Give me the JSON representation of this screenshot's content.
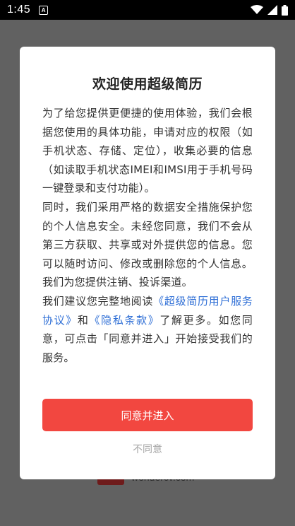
{
  "status_bar": {
    "time": "1:45",
    "notification_glyph": "A",
    "icons": [
      "wifi-icon",
      "signal-icon",
      "battery-icon"
    ]
  },
  "background": {
    "logo_text": "wondercv.com"
  },
  "dialog": {
    "title": "欢迎使用超级简历",
    "para1": "为了给您提供更便捷的使用体验，我们会根据您使用的具体功能，申请对应的权限（如手机状态、存储、定位），收集必要的信息（如读取手机状态IMEI和IMSI用于手机号码一键登录和支付功能）。",
    "para2": "同时，我们采用严格的数据安全措施保护您的个人信息安全。未经您同意，我们不会从第三方获取、共享或对外提供您的信息。您可以随时访问、修改或删除您的个人信息。我们为您提供注销、投诉渠道。",
    "para3_prefix": "我们建议您完整地阅读",
    "user_agreement_link": "《超级简历用户服务协议》",
    "para3_and": "和",
    "privacy_link": "《隐私条款》",
    "para3_suffix": "了解更多。如您同意，可点击「同意并进入」开始接受我们的服务。",
    "agree_label": "同意并进入",
    "disagree_label": "不同意"
  },
  "colors": {
    "accent": "#f24740",
    "link": "#2f6fd6"
  }
}
